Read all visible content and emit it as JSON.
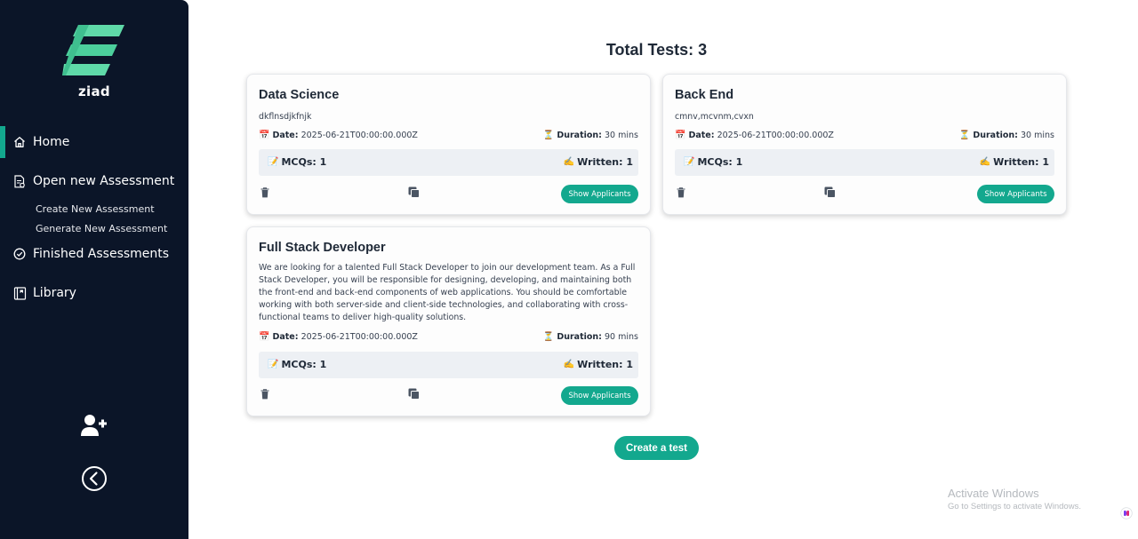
{
  "sidebar": {
    "brand": "ziad",
    "items": [
      {
        "label": "Home",
        "icon": "home-icon",
        "active": true
      },
      {
        "label": "Open new Assessment",
        "icon": "document-icon",
        "subitems": [
          "Create New Assessment",
          "Generate New Assessment"
        ]
      },
      {
        "label": "Finished Assessments",
        "icon": "check-circle-icon"
      },
      {
        "label": "Library",
        "icon": "book-icon"
      }
    ],
    "add_user_icon": "user-plus-icon",
    "collapse_icon": "chevron-left-circle-icon"
  },
  "main": {
    "title": "Total Tests: 3",
    "create_button": "Create a test",
    "labels": {
      "date": "Date:",
      "duration": "Duration:",
      "mcqs": "MCQs: 1",
      "written": "Written: 1",
      "show_applicants": "Show Applicants"
    },
    "tests": [
      {
        "title": "Data Science",
        "description": "dkflnsdjkfnjk",
        "date": "2025-06-21T00:00:00.000Z",
        "duration": "30 mins",
        "mcqs": "MCQs: 1",
        "written": "Written: 1",
        "button": "Show Applicants"
      },
      {
        "title": "Back End",
        "description": "cmnv,mcvnm,cvxn",
        "date": "2025-06-21T00:00:00.000Z",
        "duration": "30 mins",
        "mcqs": "MCQs: 1",
        "written": "Written: 1",
        "button": "Show Applicants"
      },
      {
        "title": "Full Stack Developer",
        "description_lines": [
          "We are looking for a talented Full Stack Developer to join our development team. As a Full",
          "Stack Developer, you will be responsible for designing, developing, and maintaining both",
          "the front-end and back-end components of web applications. You should be comfortable",
          "working with both server-side and client-side technologies, and collaborating with cross-",
          "functional teams to deliver high-quality solutions."
        ],
        "date": "2025-06-21T00:00:00.000Z",
        "duration": "90 mins",
        "mcqs": "MCQs: 1",
        "written": "Written: 1",
        "button": "Show Applicants"
      }
    ]
  },
  "watermark": {
    "line1": "Activate Windows",
    "line2": "Go to Settings to activate Windows."
  },
  "colors": {
    "sidebar_bg": "#0b1528",
    "accent": "#13a88e",
    "counts_bg": "#edf0f4"
  }
}
